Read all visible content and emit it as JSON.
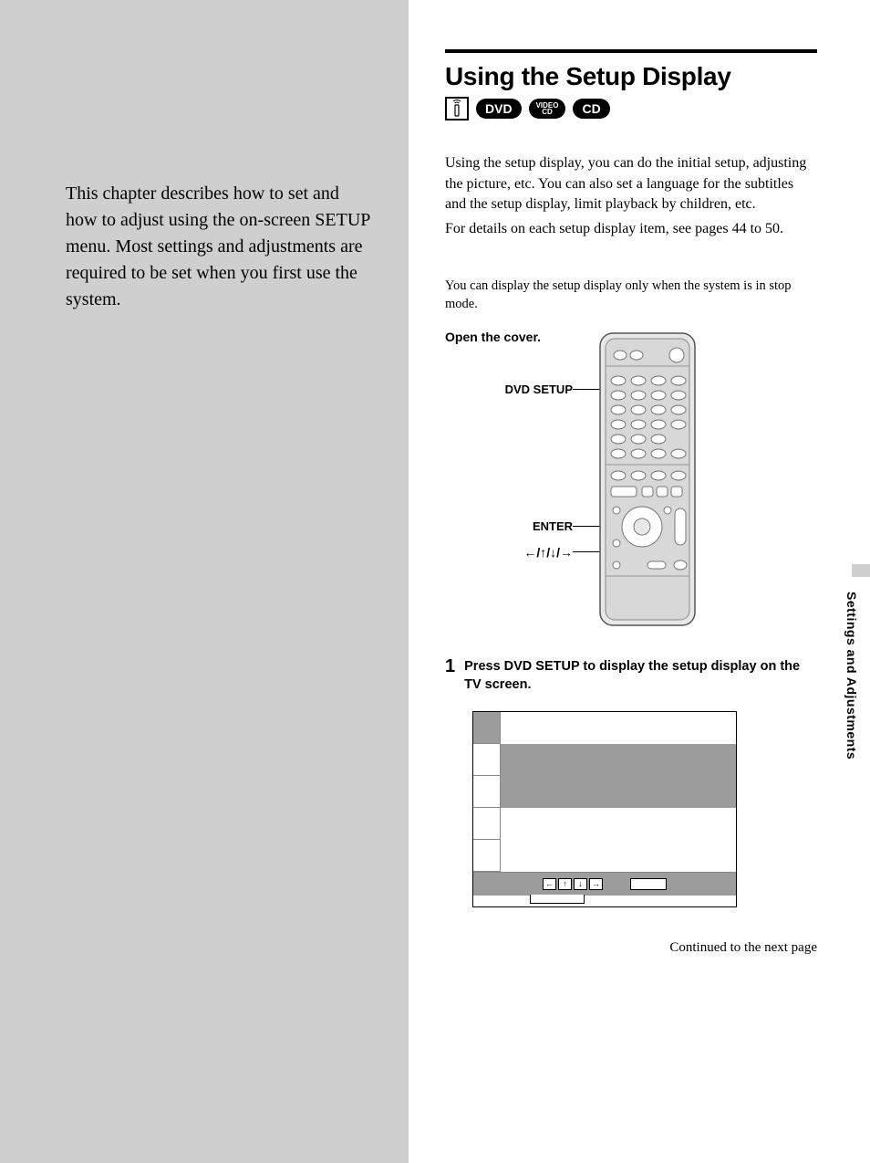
{
  "left": {
    "intro": "This chapter describes how to set and how to adjust using the on-screen SETUP menu.  Most settings and adjustments are required to be set when you first use the system."
  },
  "title": "Using the Setup Display",
  "badges": {
    "dvd": "DVD",
    "videocd": "VIDEO\nCD",
    "cd": "CD"
  },
  "para1": "Using the setup display, you can do the initial setup, adjusting the picture, etc.  You can also set a language for the subtitles and the setup display, limit playback by children, etc.",
  "para2": "For details on each setup display item, see pages 44 to 50.",
  "note": "You can display the setup display only when the system is in stop mode.",
  "diagram": {
    "open_cover": "Open the cover.",
    "callout_dvd_setup": "DVD SETUP",
    "callout_enter": "ENTER",
    "callout_arrows": "←/↑/↓/→"
  },
  "step1": {
    "num": "1",
    "text": "Press DVD SETUP to display the setup display on the TV screen."
  },
  "tv_arrows": [
    "←",
    "↑",
    "↓",
    "→"
  ],
  "continued": "Continued to the next page",
  "section_label": "Settings and Adjustments"
}
